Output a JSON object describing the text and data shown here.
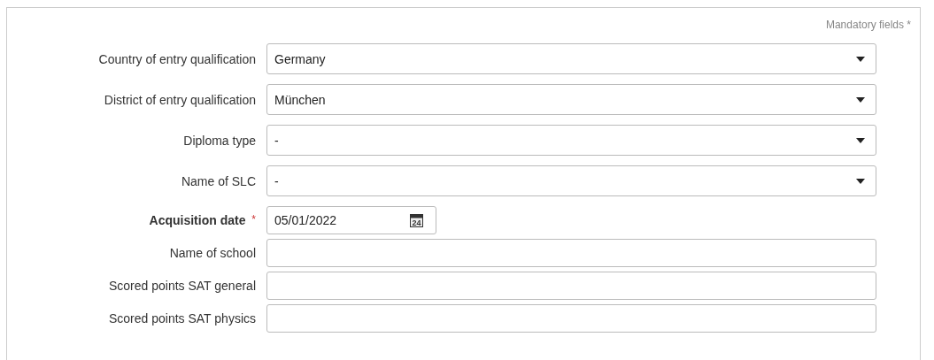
{
  "mandatory_note": "Mandatory fields *",
  "fields": [
    {
      "kind": "select",
      "label": "Country of entry qualification",
      "required": false,
      "value": "Germany"
    },
    {
      "kind": "select",
      "label": "District of entry qualification",
      "required": false,
      "value": "München"
    },
    {
      "kind": "select",
      "label": "Diploma type",
      "required": false,
      "value": "-"
    },
    {
      "kind": "select",
      "label": "Name of SLC",
      "required": false,
      "value": "-"
    },
    {
      "kind": "date",
      "label": "Acquisition date",
      "required": true,
      "required_mark": "*",
      "value": "05/01/2022",
      "calendar_day": "24"
    },
    {
      "kind": "text",
      "label": "Name of school",
      "required": false
    },
    {
      "kind": "text",
      "label": "Scored points SAT general",
      "required": false
    },
    {
      "kind": "text",
      "label": "Scored points SAT physics",
      "required": false
    }
  ]
}
